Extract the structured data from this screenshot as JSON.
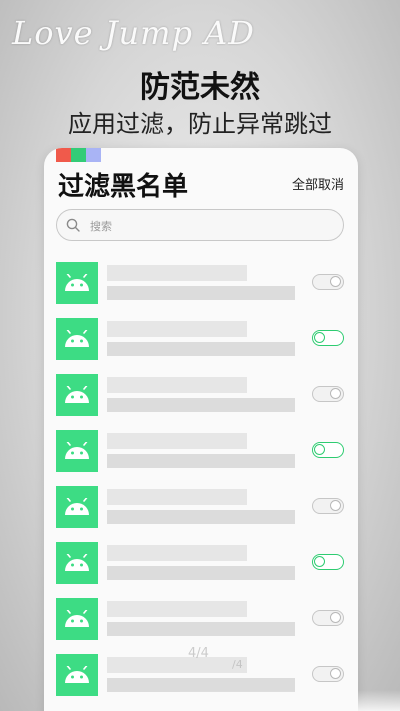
{
  "brand": "Love Jump AD",
  "headline": "防范未然",
  "subline": "应用过滤，防止异常跳过",
  "card": {
    "color_bars": [
      "#f05a4b",
      "#33cc77",
      "#a9b4f5"
    ],
    "title": "过滤黑名单",
    "deselect_all": "全部取消",
    "search_placeholder": "搜索"
  },
  "apps": [
    {
      "icon": "android-icon",
      "enabled": false
    },
    {
      "icon": "android-icon",
      "enabled": true
    },
    {
      "icon": "android-icon",
      "enabled": false
    },
    {
      "icon": "android-icon",
      "enabled": true
    },
    {
      "icon": "android-icon",
      "enabled": false
    },
    {
      "icon": "android-icon",
      "enabled": true
    },
    {
      "icon": "android-icon",
      "enabled": false
    },
    {
      "icon": "android-icon",
      "enabled": false
    }
  ],
  "page_indicator": "4/4",
  "page_indicator_ghost": "/4",
  "colors": {
    "android_green": "#3ddc84",
    "toggle_on": "#2ecc71"
  }
}
